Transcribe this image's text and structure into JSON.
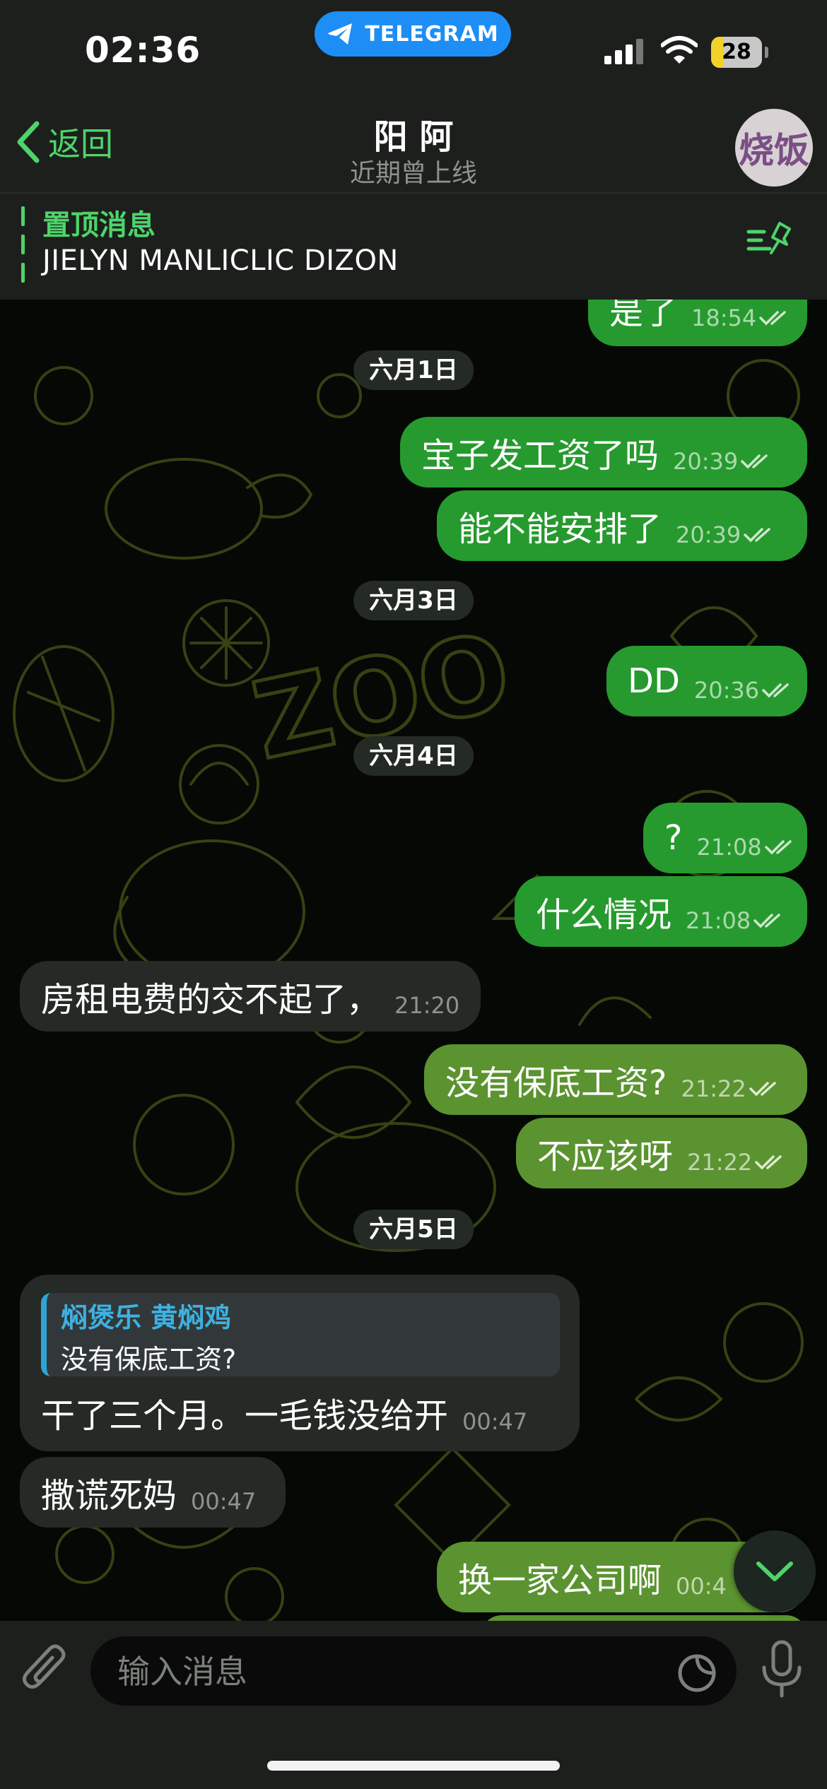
{
  "status_bar": {
    "time": "02:36",
    "app_pill": "TELEGRAM",
    "battery": "28"
  },
  "header": {
    "back_label": "返回",
    "title": "阳 阿",
    "subtitle": "近期曾上线",
    "avatar_text": "烧饭"
  },
  "pinned": {
    "title": "置顶消息",
    "text": "JIELYN MANLICLIC DIZON"
  },
  "messages": {
    "partial_out": {
      "text": "是了",
      "time": "18:54"
    },
    "date_1": "六月1日",
    "m1": {
      "text": "宝子发工资了吗",
      "time": "20:39"
    },
    "m2": {
      "text": "能不能安排了",
      "time": "20:39"
    },
    "date_2": "六月3日",
    "m3": {
      "text": "DD",
      "time": "20:36"
    },
    "date_3": "六月4日",
    "m4": {
      "text": "?",
      "time": "21:08"
    },
    "m5": {
      "text": "什么情况",
      "time": "21:08"
    },
    "m6": {
      "text": "房租电费的交不起了，",
      "time": "21:20"
    },
    "m7": {
      "text": "没有保底工资?",
      "time": "21:22"
    },
    "m8": {
      "text": "不应该呀",
      "time": "21:22"
    },
    "date_4": "六月5日",
    "m9": {
      "quote_author": "焖煲乐 黄焖鸡",
      "quote_text": "没有保底工资?",
      "text": "干了三个月。一毛钱没给开",
      "time": "00:47"
    },
    "m10": {
      "text": "撒谎死妈",
      "time": "00:47"
    },
    "m11": {
      "text": "换一家公司啊",
      "time": "00:4"
    }
  },
  "input": {
    "placeholder": "输入消息"
  },
  "colors": {
    "accent": "#4dd46a",
    "outgoing": "#269a2e",
    "outgoing_alt": "#5b9330",
    "incoming": "#262a26",
    "telegram_blue": "#1d8ef5",
    "quote_accent": "#2fa4d4"
  }
}
